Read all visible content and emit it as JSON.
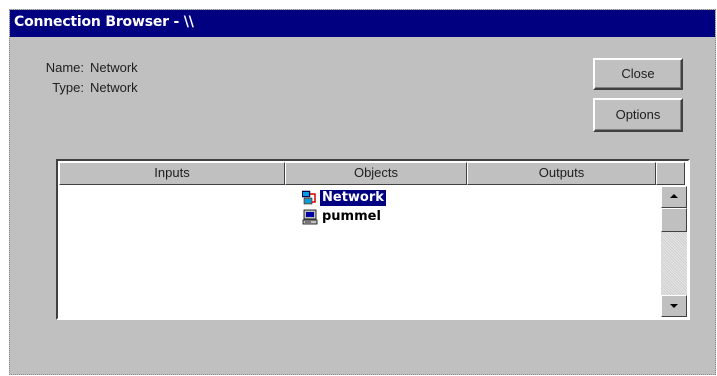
{
  "window": {
    "title": "Connection Browser - \\\\"
  },
  "info": {
    "name_label": "Name:",
    "name_value": "Network",
    "type_label": "Type:",
    "type_value": "Network"
  },
  "buttons": {
    "close_label": "Close",
    "options_label": "Options"
  },
  "list": {
    "columns": [
      "Inputs",
      "Objects",
      "Outputs"
    ],
    "objects": [
      {
        "label": "Network",
        "icon": "network-icon",
        "selected": true
      },
      {
        "label": "pummel",
        "icon": "computer-icon",
        "selected": false
      }
    ]
  },
  "colors": {
    "titlebar": "#000080",
    "window_bg": "#c0c0c0",
    "selection": "#000080"
  }
}
